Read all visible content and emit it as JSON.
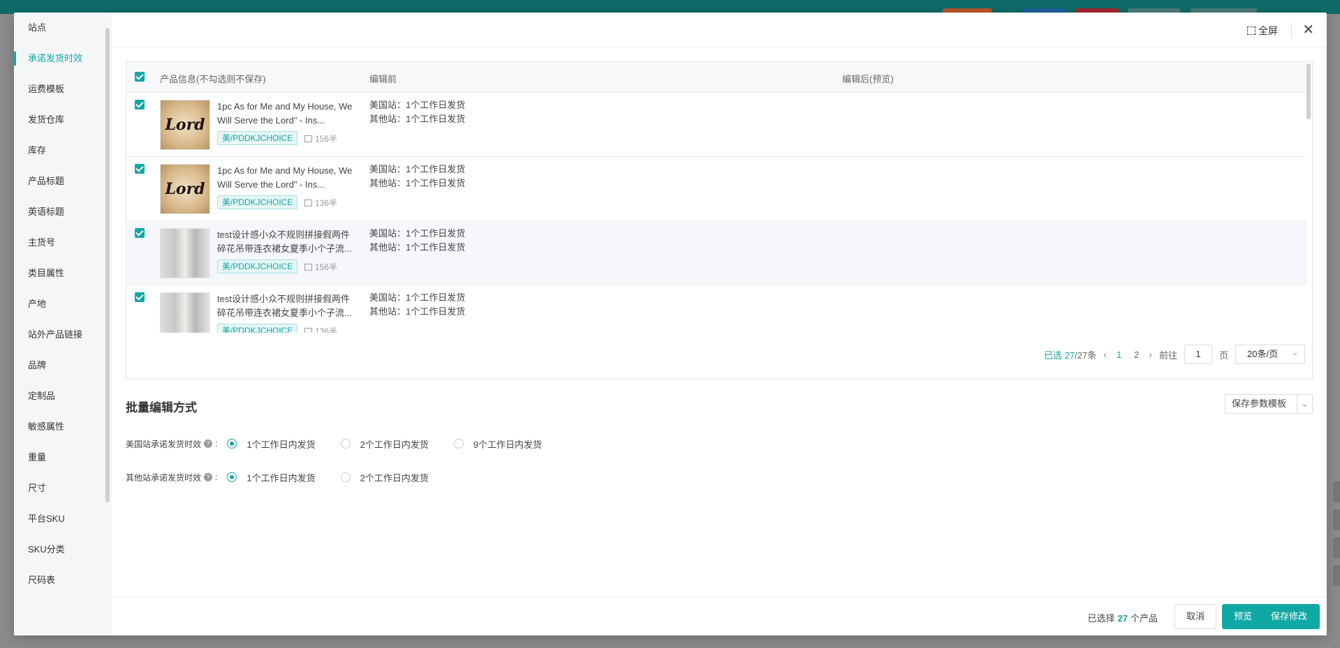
{
  "sidenav": {
    "items": [
      {
        "label": "站点"
      },
      {
        "label": "承诺发货时效"
      },
      {
        "label": "运费模板"
      },
      {
        "label": "发货仓库"
      },
      {
        "label": "库存"
      },
      {
        "label": "产品标题"
      },
      {
        "label": "英语标题"
      },
      {
        "label": "主货号"
      },
      {
        "label": "类目属性"
      },
      {
        "label": "产地"
      },
      {
        "label": "站外产品链接"
      },
      {
        "label": "品牌"
      },
      {
        "label": "定制品"
      },
      {
        "label": "敏感属性"
      },
      {
        "label": "重量"
      },
      {
        "label": "尺寸"
      },
      {
        "label": "平台SKU"
      },
      {
        "label": "SKU分类"
      },
      {
        "label": "尺码表"
      }
    ],
    "active_index": 1
  },
  "header": {
    "fullscreen_label": "全屏",
    "close_icon": "close-icon"
  },
  "table": {
    "columns": [
      "产品信息(不勾选则不保存)",
      "编辑前",
      "编辑后(预览)"
    ],
    "rows": [
      {
        "title": "1pc As for Me and My House, We Will Serve the Lord\" - Ins...",
        "tag": "美/PDDKJCHOICE",
        "stock": "156半",
        "before_us": "美国站：1个工作日发货",
        "before_other": "其他站：1个工作日发货",
        "thumb": "Lord"
      },
      {
        "title": "1pc As for Me and My House, We Will Serve the Lord\" - Ins...",
        "tag": "美/PDDKJCHOICE",
        "stock": "136半",
        "before_us": "美国站：1个工作日发货",
        "before_other": "其他站：1个工作日发货",
        "thumb": "Lord"
      },
      {
        "title": "test设计感小众不规则拼接假两件碎花吊带连衣裙女夏季小个子流...",
        "tag": "美/PDDKJCHOICE",
        "stock": "156半",
        "before_us": "美国站：1个工作日发货",
        "before_other": "其他站：1个工作日发货",
        "thumb": ""
      },
      {
        "title": "test设计感小众不规则拼接假两件碎花吊带连衣裙女夏季小个子流...",
        "tag": "美/PDDKJCHOICE",
        "stock": "136半",
        "before_us": "美国站：1个工作日发货",
        "before_other": "其他站：1个工作日发货",
        "thumb": ""
      }
    ]
  },
  "pager": {
    "selected_prefix": "已选 27",
    "total": "/27条",
    "pages": [
      "1",
      "2"
    ],
    "current_page": "1",
    "goto_label": "前往",
    "goto_value": "1",
    "page_unit": "页",
    "page_size": "20条/页"
  },
  "batch": {
    "title": "批量编辑方式",
    "template_button": "保存参数模板",
    "us_label": "美国站承诺发货时效",
    "us_options": [
      "1个工作日内发货",
      "2个工作日内发货",
      "9个工作日内发货"
    ],
    "us_selected": 0,
    "other_label": "其他站承诺发货时效",
    "other_options": [
      "1个工作日内发货",
      "2个工作日内发货"
    ],
    "other_selected": 0
  },
  "footer": {
    "selected_prefix": "已选择",
    "selected_count": "27",
    "selected_suffix": "个产品",
    "cancel": "取消",
    "preview": "预览",
    "save": "保存修改"
  },
  "colors": {
    "accent": "#0fa8a5",
    "topbar": "#0e6b68"
  }
}
